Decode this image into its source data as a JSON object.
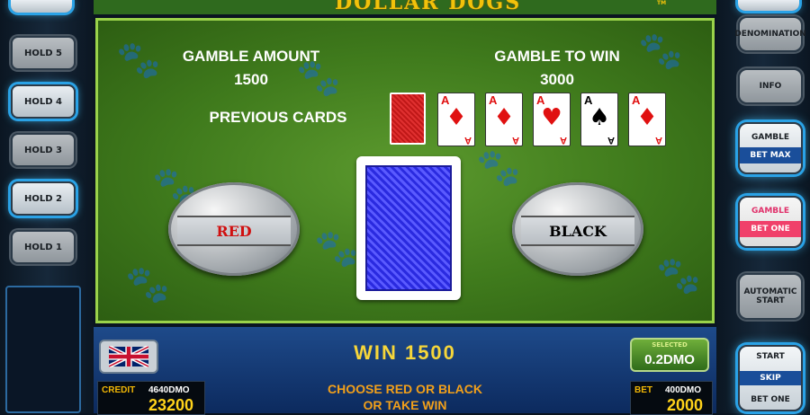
{
  "title": {
    "logo_text": "DOLLAR DOGS",
    "trademark": "TM"
  },
  "left_buttons": [
    {
      "label": "HOLD 5"
    },
    {
      "label": "HOLD 4"
    },
    {
      "label": "HOLD 3"
    },
    {
      "label": "HOLD 2"
    },
    {
      "label": "HOLD 1"
    }
  ],
  "right_buttons": {
    "denomination": "DENOMINATION",
    "info": "INFO",
    "gamble_max": {
      "top": "GAMBLE",
      "bottom": "BET MAX"
    },
    "gamble_one": {
      "top": "GAMBLE",
      "bottom": "BET ONE"
    },
    "auto_start": {
      "line1": "AUTOMATIC",
      "line2": "START"
    },
    "start_skip": {
      "start": "START",
      "skip": "SKIP",
      "bet_one": "BET ONE"
    }
  },
  "gamble": {
    "amount_label": "GAMBLE AMOUNT",
    "amount_value": "1500",
    "to_win_label": "GAMBLE TO WIN",
    "to_win_value": "3000",
    "previous_cards_label": "PREVIOUS CARDS",
    "red_label": "RED",
    "black_label": "BLACK"
  },
  "previous_cards": [
    {
      "rank": "A",
      "suit": "♦",
      "color": "red"
    },
    {
      "rank": "A",
      "suit": "♦",
      "color": "red"
    },
    {
      "rank": "A",
      "suit": "♥",
      "color": "red"
    },
    {
      "rank": "A",
      "suit": "♠",
      "color": "black"
    },
    {
      "rank": "A",
      "suit": "♦",
      "color": "red"
    }
  ],
  "status": {
    "win": "WIN 1500",
    "denomination_label": "SELECTED",
    "denomination_value": "0.2DMO",
    "credit_label": "CREDIT",
    "credit_dmo": "4640DMO",
    "credit_value": "23200",
    "bet_label": "BET",
    "bet_dmo": "400DMO",
    "bet_value": "2000",
    "message_line1": "CHOOSE RED OR BLACK",
    "message_line2": "OR TAKE WIN"
  },
  "colors": {
    "accent": "#2aa2e6",
    "felt": "#4a8a22",
    "win_text": "#f6d63a",
    "gamble_one_band": "#f0406a",
    "gamble_max_band": "#1a4e9a"
  }
}
